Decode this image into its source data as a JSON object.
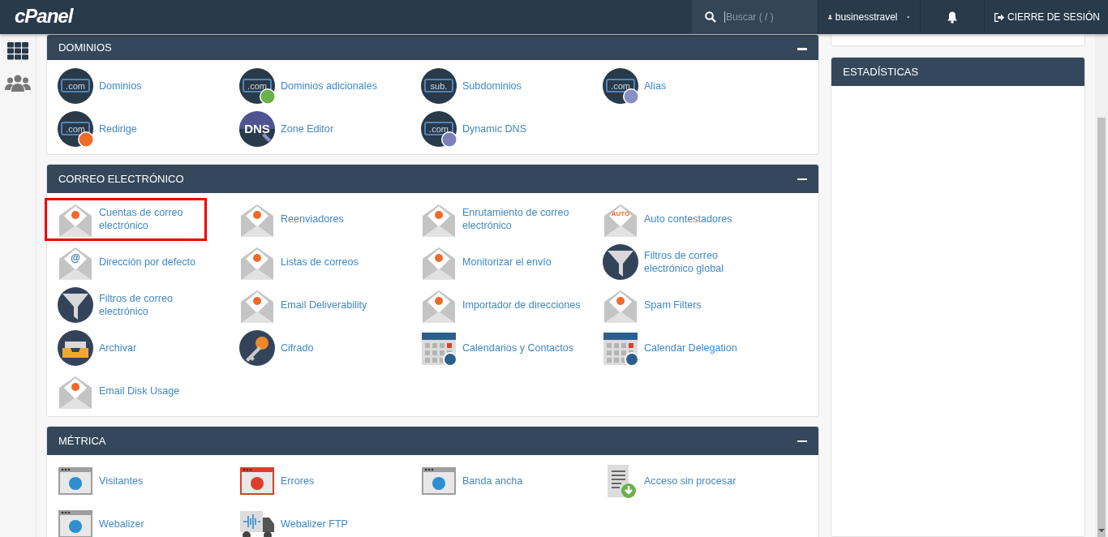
{
  "header": {
    "logo": "cPanel",
    "search": {
      "placeholder": "Buscar ( / )"
    },
    "user": "businesstravel",
    "logout": "CIERRE DE SESIÓN"
  },
  "sections": [
    {
      "title": "DOMINIOS",
      "expanded": true,
      "items": [
        {
          "label": "Dominios",
          "kind": "domain",
          "icon_text": ".com"
        },
        {
          "label": "Dominios adicionales",
          "kind": "domain",
          "icon_text": ".com",
          "color": "#6ab04c"
        },
        {
          "label": "Subdominios",
          "kind": "domain",
          "icon_text": "sub."
        },
        {
          "label": "Alias",
          "kind": "domain",
          "icon_text": ".com",
          "color": "#8a8fc4"
        },
        {
          "label": "Redirige",
          "kind": "domain",
          "icon_text": ".com",
          "color": "#f06a2a"
        },
        {
          "label": "Zone Editor",
          "kind": "dns",
          "icon_text": "DNS"
        },
        {
          "label": "Dynamic DNS",
          "kind": "domain",
          "icon_text": ".com",
          "color": "#7b80b8"
        }
      ]
    },
    {
      "title": "CORREO ELECTRÓNICO",
      "expanded": true,
      "items": [
        {
          "label": "Cuentas de correo electrónico",
          "kind": "envelope",
          "highlighted": true
        },
        {
          "label": "Reenviadores",
          "kind": "envelope",
          "highlighted": false
        },
        {
          "label": "Enrutamiento de correo electrónico",
          "kind": "envelope",
          "highlighted": false
        },
        {
          "label": "Auto contestadores",
          "kind": "envelope",
          "icon_text": "AUTO",
          "highlighted": false
        },
        {
          "label": "Dirección por defecto",
          "kind": "envelope",
          "icon_text": "@",
          "highlighted": false
        },
        {
          "label": "Listas de correos",
          "kind": "envelope",
          "highlighted": false
        },
        {
          "label": "Monitorizar el envío",
          "kind": "envelope",
          "highlighted": false
        },
        {
          "label": "Filtros de correo electrónico global",
          "kind": "funnel",
          "highlighted": false
        },
        {
          "label": "Filtros de correo electrónico",
          "kind": "funnel",
          "highlighted": false
        },
        {
          "label": "Email Deliverability",
          "kind": "envelope",
          "highlighted": false
        },
        {
          "label": "Importador de direcciones",
          "kind": "envelope",
          "highlighted": false
        },
        {
          "label": "Spam Filters",
          "kind": "envelope",
          "highlighted": false
        },
        {
          "label": "Archivar",
          "kind": "archive",
          "highlighted": false
        },
        {
          "label": "Cifrado",
          "kind": "key",
          "highlighted": false
        },
        {
          "label": "Calendarios y Contactos",
          "kind": "calendar",
          "highlighted": false
        },
        {
          "label": "Calendar Delegation",
          "kind": "calendar",
          "highlighted": false
        },
        {
          "label": "Email Disk Usage",
          "kind": "envelope",
          "highlighted": false
        }
      ]
    },
    {
      "title": "MÉTRICA",
      "expanded": true,
      "items": [
        {
          "label": "Visitantes",
          "kind": "window",
          "color": "#9e9e9e"
        },
        {
          "label": "Errores",
          "kind": "window",
          "color": "#d9402b"
        },
        {
          "label": "Banda ancha",
          "kind": "window",
          "color": "#9e9e9e"
        },
        {
          "label": "Acceso sin procesar",
          "kind": "document"
        },
        {
          "label": "Webalizer",
          "kind": "window",
          "color": "#9e9e9e"
        },
        {
          "label": "Webalizer FTP",
          "kind": "truck"
        }
      ]
    }
  ],
  "side_panel": {
    "title": "ESTADÍSTICAS"
  }
}
